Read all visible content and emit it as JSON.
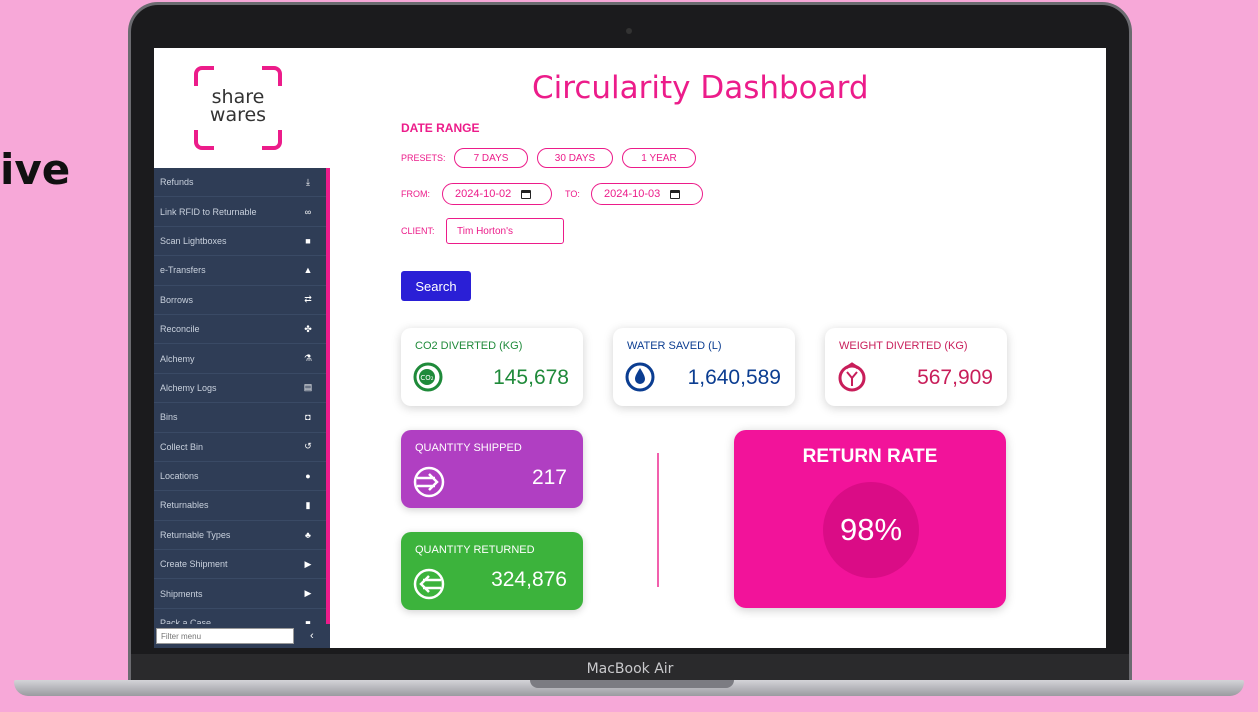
{
  "background_text": "ive",
  "device_label": "MacBook Air",
  "logo": {
    "line1": "share",
    "line2": "wares"
  },
  "title": "Circularity Dashboard",
  "sidebar": {
    "items": [
      {
        "label": "Refunds",
        "icon": "download-icon"
      },
      {
        "label": "Link RFID to Returnable",
        "icon": "link-icon"
      },
      {
        "label": "Scan Lightboxes",
        "icon": "box-icon"
      },
      {
        "label": "e-Transfers",
        "icon": "bank-icon"
      },
      {
        "label": "Borrows",
        "icon": "repeat-icon"
      },
      {
        "label": "Reconcile",
        "icon": "handshake-icon"
      },
      {
        "label": "Alchemy",
        "icon": "flask-icon"
      },
      {
        "label": "Alchemy Logs",
        "icon": "log-icon"
      },
      {
        "label": "Bins",
        "icon": "bin-icon"
      },
      {
        "label": "Collect Bin",
        "icon": "undo-icon"
      },
      {
        "label": "Locations",
        "icon": "pin-icon"
      },
      {
        "label": "Returnables",
        "icon": "cup-icon"
      },
      {
        "label": "Returnable Types",
        "icon": "shapes-icon"
      },
      {
        "label": "Create Shipment",
        "icon": "truck-icon"
      },
      {
        "label": "Shipments",
        "icon": "truck-icon"
      },
      {
        "label": "Pack a Case",
        "icon": "box-icon"
      }
    ],
    "filter_placeholder": "Filter menu",
    "collapse_glyph": "‹"
  },
  "filters": {
    "section_label": "DATE RANGE",
    "presets_label": "PRESETS:",
    "presets": [
      "7 DAYS",
      "30 DAYS",
      "1 YEAR"
    ],
    "from_label": "FROM:",
    "from_value": "2024-10-02",
    "to_label": "TO:",
    "to_value": "2024-10-03",
    "client_label": "CLIENT:",
    "client_value": "Tim Horton's",
    "search_label": "Search"
  },
  "stats": [
    {
      "label": "CO2 DIVERTED (KG)",
      "value": "145,678",
      "color": "#1f8a3a",
      "icon": "co2-icon"
    },
    {
      "label": "WATER SAVED (L)",
      "value": "1,640,589",
      "color": "#0b3d91",
      "icon": "water-drop-icon"
    },
    {
      "label": "WEIGHT DIVERTED (KG)",
      "value": "567,909",
      "color": "#c81e5a",
      "icon": "weight-icon"
    }
  ],
  "quantities": {
    "shipped": {
      "label": "QUANTITY SHIPPED",
      "value": "217",
      "color": "#b03fc2",
      "icon": "shipped-arrow-icon"
    },
    "returned": {
      "label": "QUANTITY RETURNED",
      "value": "324,876",
      "color": "#3cb33c",
      "icon": "returned-arrow-icon"
    }
  },
  "return_rate": {
    "label": "RETURN RATE",
    "value": "98%",
    "color": "#f2139a"
  }
}
